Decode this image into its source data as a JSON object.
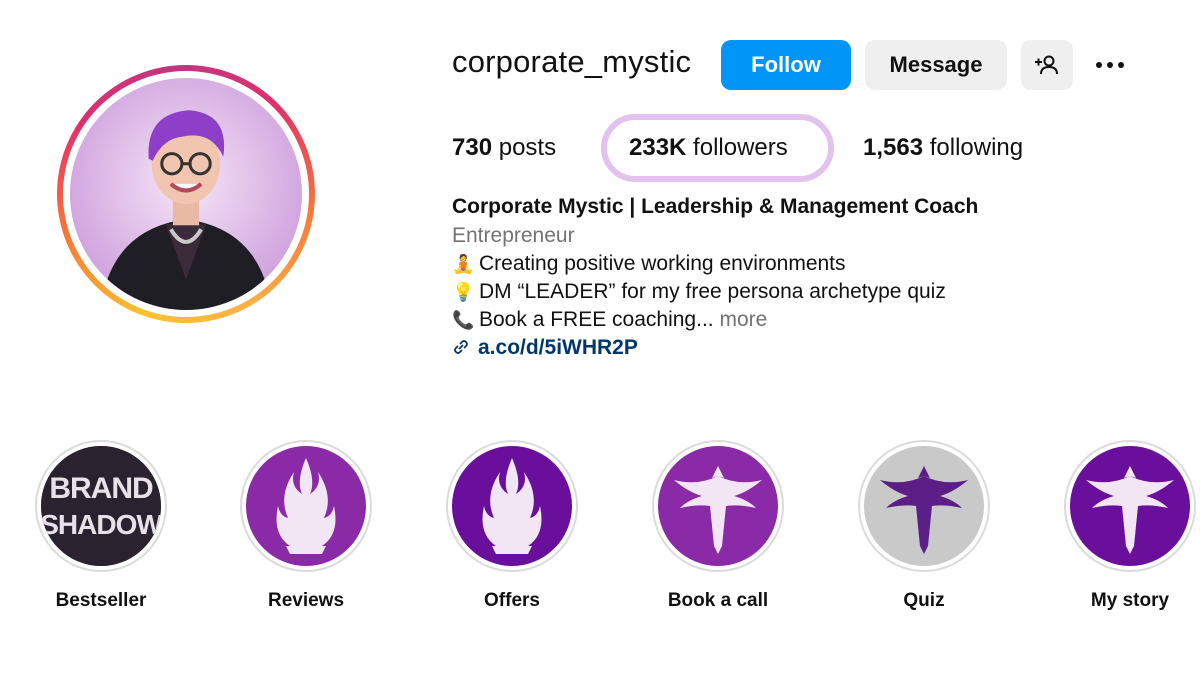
{
  "profile": {
    "username": "corporate_mystic",
    "follow_label": "Follow",
    "message_label": "Message",
    "add_user_icon": "person-add-icon",
    "more_icon": "more-options-icon"
  },
  "stats": {
    "posts_count": "730",
    "posts_label": "posts",
    "followers_count": "233K",
    "followers_label": "followers",
    "following_count": "1,563",
    "following_label": "following"
  },
  "bio": {
    "name": "Corporate Mystic | Leadership & Management Coach",
    "category": "Entrepreneur",
    "line1": "Creating positive working environments",
    "line2": "DM “LEADER” for my free persona archetype quiz",
    "line3": "Book a FREE coaching...",
    "more": "more",
    "link": "a.co/d/5iWHR2P",
    "line1_icon": "meditation-emoji-icon",
    "line2_icon": "lightbulb-emoji-icon",
    "line3_icon": "phone-emoji-icon",
    "link_icon": "link-icon"
  },
  "highlights": [
    {
      "label": "Bestseller",
      "cover": "BRAND SHADOW"
    },
    {
      "label": "Reviews"
    },
    {
      "label": "Offers"
    },
    {
      "label": "Book a call"
    },
    {
      "label": "Quiz"
    },
    {
      "label": "My story"
    }
  ],
  "colors": {
    "follow_button": "#0095f6",
    "secondary_button": "#efefef",
    "link": "#00376b",
    "highlight_outline": "#e3c2f0",
    "purple_cover": "#8a2aa6",
    "deep_purple_cover": "#6a0f9c"
  }
}
